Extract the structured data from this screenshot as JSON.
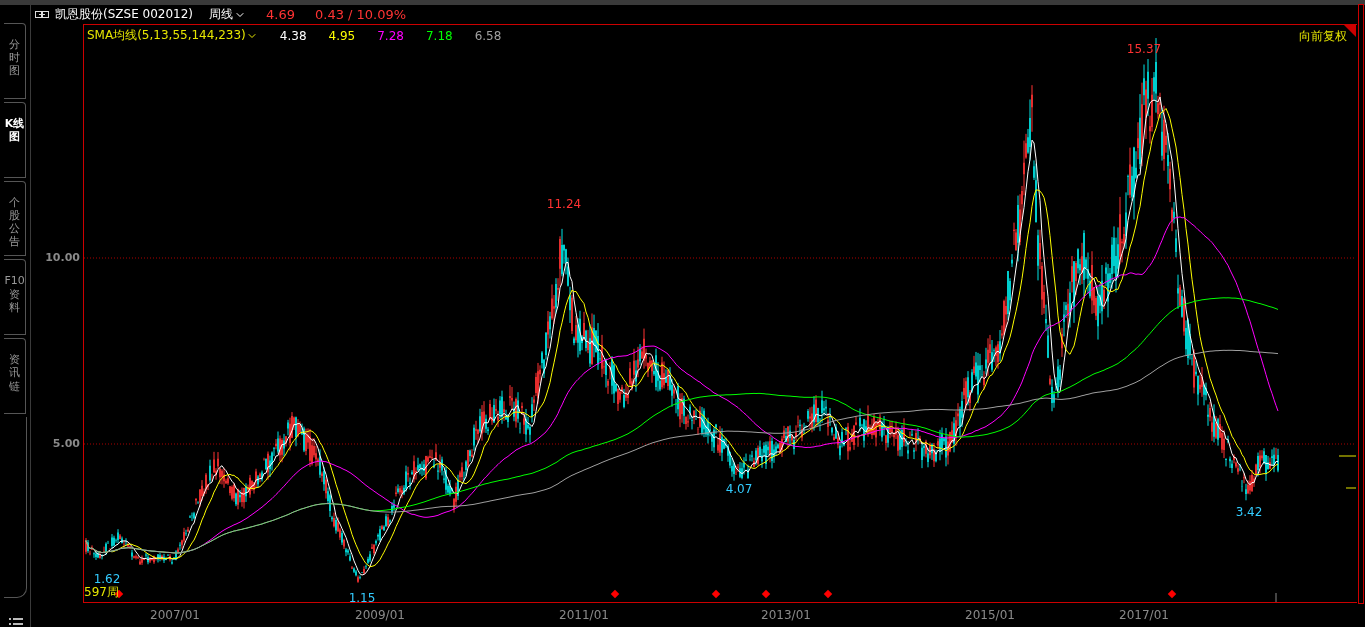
{
  "header": {
    "stock": "凯恩股份(SZSE 002012)",
    "period": "周线",
    "price": "4.69",
    "change": "0.43 / 10.09%"
  },
  "sidebar": {
    "tabs": [
      {
        "label": "分时图",
        "selected": false
      },
      {
        "label": "K线图",
        "selected": true
      },
      {
        "label": "个股公告",
        "selected": false
      },
      {
        "label": "F10资料",
        "selected": false
      },
      {
        "label": "资讯链",
        "selected": false
      }
    ]
  },
  "legend": {
    "indicator": "SMA均线(5,13,55,144,233)",
    "values": [
      {
        "value": "4.38",
        "color": "#ffffff"
      },
      {
        "value": "4.95",
        "color": "#ffff00"
      },
      {
        "value": "7.28",
        "color": "#ff00ff"
      },
      {
        "value": "7.18",
        "color": "#00ff00"
      },
      {
        "value": "6.58",
        "color": "#a0a0a0"
      }
    ]
  },
  "adjustment": "向前复权",
  "chart": {
    "price_labels": [
      {
        "text": "15.37",
        "kind": "high"
      },
      {
        "text": "11.24",
        "kind": "high"
      },
      {
        "text": "4.07",
        "kind": "low"
      },
      {
        "text": "1.62",
        "kind": "low"
      },
      {
        "text": "1.15",
        "kind": "low"
      },
      {
        "text": "3.42",
        "kind": "low"
      }
    ],
    "bar_count": "597周",
    "y_ticks": [
      "10.00",
      "5.00"
    ],
    "x_labels": [
      "2007/01",
      "2009/01",
      "2011/01",
      "2013/01",
      "2015/01",
      "2017/01"
    ]
  }
}
